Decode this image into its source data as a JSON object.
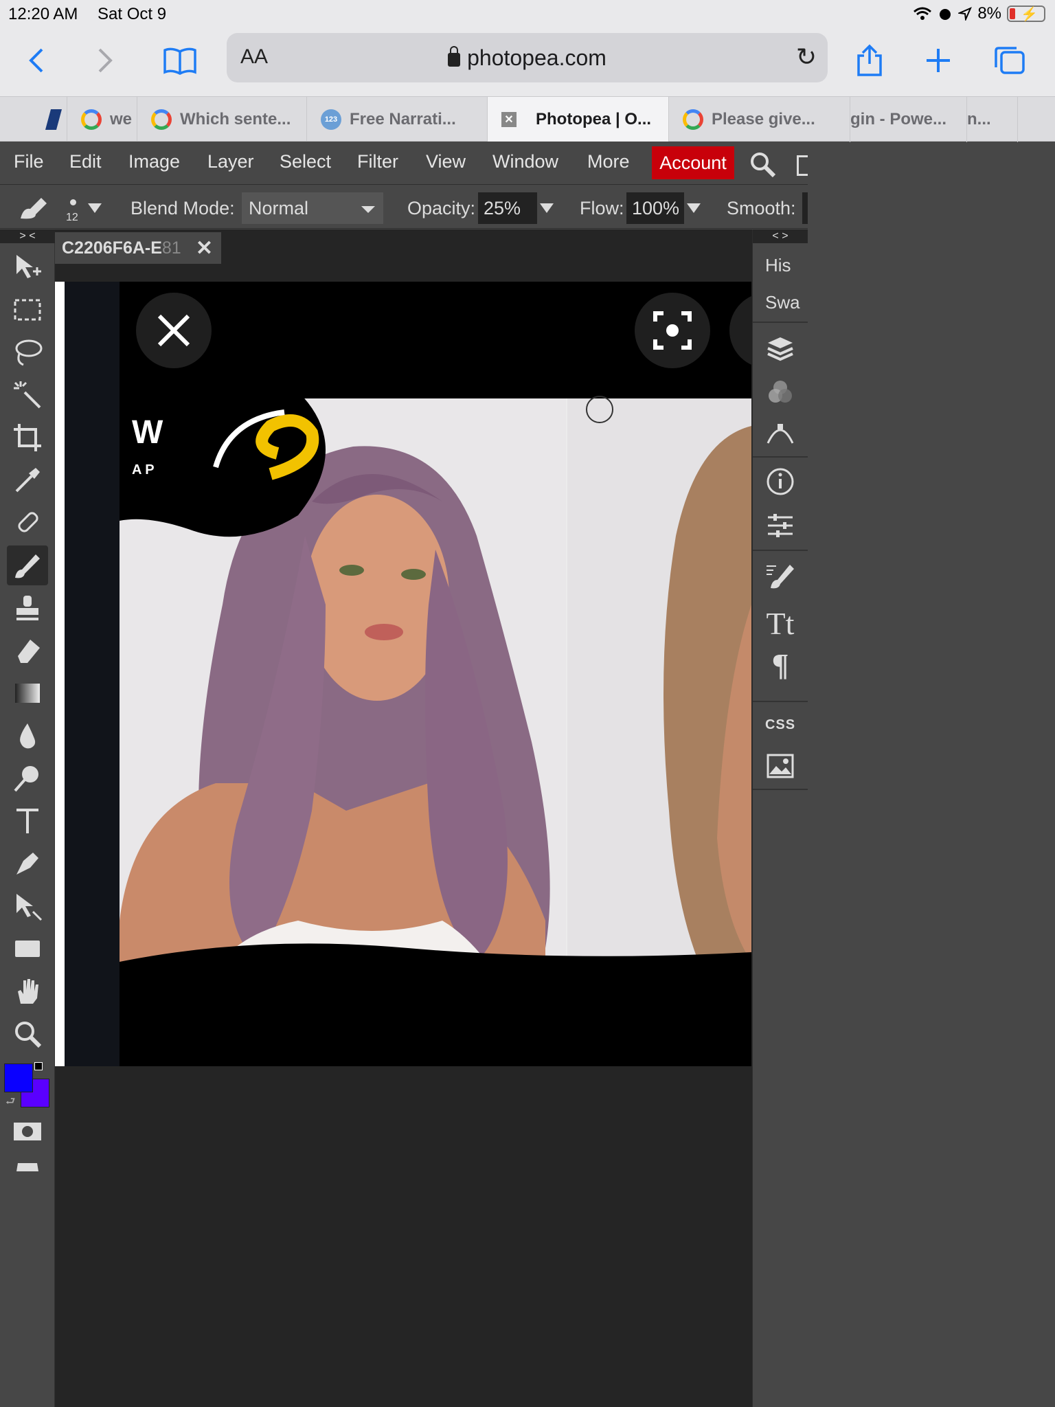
{
  "status_bar": {
    "time": "12:20 AM",
    "date": "Sat Oct 9",
    "battery": "8%"
  },
  "browser": {
    "aa_label": "AA",
    "url": "photopea.com",
    "tabs": [
      {
        "label": "we",
        "icon": "google-icon",
        "active": false
      },
      {
        "label": "Which sente...",
        "icon": "google-icon",
        "active": false
      },
      {
        "label": "Free Narrati...",
        "icon": "123-icon",
        "active": false
      },
      {
        "label": "Photopea | O...",
        "icon": "close-icon",
        "active": true
      },
      {
        "label": "Please give...",
        "icon": "google-icon",
        "active": false
      },
      {
        "label": "gin - Powe...",
        "icon": "",
        "active": false
      },
      {
        "label": "n...",
        "icon": "",
        "active": false
      }
    ]
  },
  "menu": {
    "items": [
      "File",
      "Edit",
      "Image",
      "Layer",
      "Select",
      "Filter",
      "View",
      "Window",
      "More"
    ],
    "account": "Account"
  },
  "options": {
    "brush_size": "12",
    "blend_label": "Blend Mode:",
    "blend_value": "Normal",
    "opacity_label": "Opacity:",
    "opacity_value": "25%",
    "flow_label": "Flow:",
    "flow_value": "100%",
    "smooth_label": "Smooth:"
  },
  "document": {
    "tab_name_a": "C2206F6A-E",
    "tab_name_b": "81",
    "close": "✕"
  },
  "colors": {
    "foreground": "#0a00ff",
    "background": "#5a00ff",
    "accent": "#c8000a"
  },
  "right_panel": {
    "history_short": "His",
    "swatches_short": "Swa",
    "css_label": "CSS",
    "collapse": "< >"
  },
  "toolbar": {
    "collapse": "> <"
  },
  "canvas_overlay": {
    "logo_letter": "W",
    "logo_sub": "A P"
  }
}
